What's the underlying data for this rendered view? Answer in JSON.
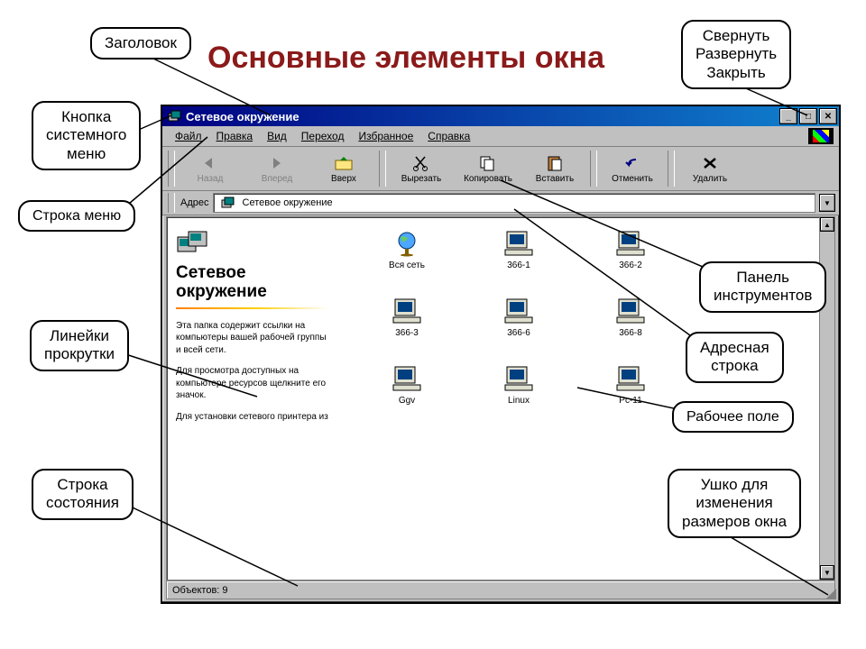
{
  "page_title": "Основные элементы окна",
  "callouts": {
    "title_label": "Заголовок",
    "sysmenu": "Кнопка\nсистемного\nменю",
    "winctrl": "Свернуть\nРазвернуть\nЗакрыть",
    "menubar": "Строка меню",
    "scrollbars": "Линейки\nпрокрутки",
    "statusbar": "Строка\nсостояния",
    "toolbar": "Панель\nинструментов",
    "addressbar": "Адресная\nстрока",
    "workarea": "Рабочее поле",
    "resize": "Ушко для\nизменения\nразмеров окна"
  },
  "window": {
    "title": "Сетевое окружение",
    "menu": [
      "Файл",
      "Правка",
      "Вид",
      "Переход",
      "Избранное",
      "Справка"
    ],
    "toolbar": [
      {
        "label": "Назад",
        "disabled": true
      },
      {
        "label": "Вперед",
        "disabled": true
      },
      {
        "label": "Вверх",
        "disabled": false
      },
      {
        "label": "Вырезать",
        "disabled": false
      },
      {
        "label": "Копировать",
        "disabled": false
      },
      {
        "label": "Вставить",
        "disabled": false
      },
      {
        "label": "Отменить",
        "disabled": false
      },
      {
        "label": "Удалить",
        "disabled": false
      }
    ],
    "address_label": "Адрес",
    "address_value": "Сетевое окружение",
    "leftpanel": {
      "heading": "Сетевое\nокружение",
      "para1": "Эта папка содержит ссылки на компьютеры вашей рабочей группы и всей сети.",
      "para2": "Для просмотра доступных на компьютере ресурсов щелкните его значок.",
      "para3": "Для установки сетевого принтера из"
    },
    "items": [
      {
        "label": "Вся сеть",
        "type": "globe"
      },
      {
        "label": "366-1",
        "type": "pc"
      },
      {
        "label": "366-2",
        "type": "pc"
      },
      {
        "label": "366-3",
        "type": "pc"
      },
      {
        "label": "366-6",
        "type": "pc"
      },
      {
        "label": "366-8",
        "type": "pc"
      },
      {
        "label": "Ggv",
        "type": "pc"
      },
      {
        "label": "Linux",
        "type": "pc"
      },
      {
        "label": "Pc-11",
        "type": "pc"
      }
    ],
    "status": "Объектов: 9"
  }
}
